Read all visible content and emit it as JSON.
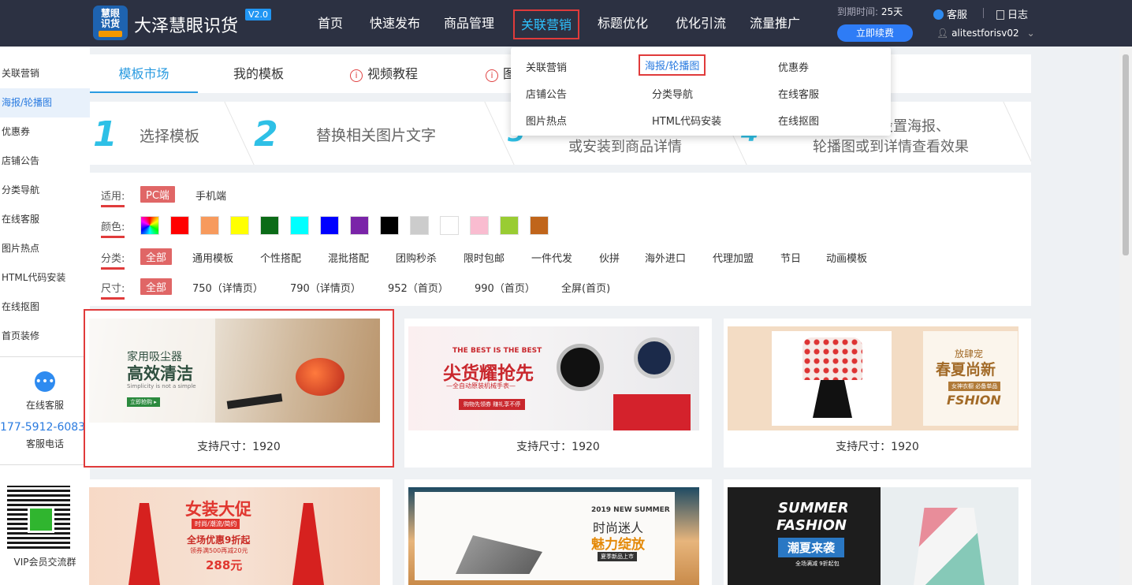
{
  "header": {
    "logo_text": "慧眼识货",
    "brand": "大泽慧眼识货",
    "version": "V2.0",
    "nav": [
      "首页",
      "快速发布",
      "商品管理",
      "关联营销",
      "标题优化",
      "优化引流",
      "流量推广"
    ],
    "expire_label": "到期时间:",
    "expire_value": "25天",
    "renew": "立即续费",
    "service": "客服",
    "log": "日志",
    "user": "alitestforisv02"
  },
  "dropdown": {
    "items": [
      "关联营销",
      "海报/轮播图",
      "优惠券",
      "店铺公告",
      "分类导航",
      "在线客服",
      "图片热点",
      "HTML代码安装",
      "在线抠图"
    ]
  },
  "sidebar": {
    "items": [
      "关联营销",
      "海报/轮播图",
      "优惠券",
      "店铺公告",
      "分类导航",
      "在线客服",
      "图片热点",
      "HTML代码安装",
      "在线抠图",
      "首页装修"
    ],
    "service": "在线客服",
    "phone": "177-5912-6083",
    "phone_label": "客服电话",
    "vip": "VIP会员交流群"
  },
  "tabs": [
    "模板市场",
    "我的模板",
    "视频教程",
    "图"
  ],
  "steps": {
    "s1_num": "1",
    "s1_text": "选择模板",
    "s2_num": "2",
    "s2_text": "替换相关图片文字",
    "s3_text": "或安装到商品详情",
    "s4_text_a": "台设置海报、",
    "s4_text_b": "轮播图或到详情查看效果"
  },
  "filters": {
    "apply_label": "适用:",
    "apply_opts": [
      "PC端",
      "手机端"
    ],
    "color_label": "颜色:",
    "colors": [
      "#ff0000",
      "#f79a5d",
      "#ffff00",
      "#0b6b17",
      "#00ffff",
      "#0000ff",
      "#7a24a8",
      "#000000",
      "#cccccc",
      "#ffffff",
      "#f9bcd0",
      "#99cc33",
      "#c0651b"
    ],
    "cat_label": "分类:",
    "cat_opts": [
      "全部",
      "通用模板",
      "个性搭配",
      "混批搭配",
      "团购秒杀",
      "限时包邮",
      "一件代发",
      "伙拼",
      "海外进口",
      "代理加盟",
      "节日",
      "动画模板"
    ],
    "size_label": "尺寸:",
    "size_opts": [
      "全部",
      "750（详情页）",
      "790（详情页）",
      "952（首页）",
      "990（首页）",
      "全屏(首页)"
    ]
  },
  "cards": [
    {
      "caption": "支持尺寸：1920",
      "t1": "家用吸尘器",
      "t2": "高效清洁",
      "t3": "Simplicity is not a simple",
      "t4": "立即抢购 ▸"
    },
    {
      "caption": "支持尺寸：1920",
      "t1": "THE BEST IS THE BEST",
      "t2": "尖货耀抢先",
      "t3": "—全自动原装机械手表—",
      "t4": "购物先领券 赚礼享不停"
    },
    {
      "caption": "支持尺寸：1920",
      "t1": "放肆宠",
      "t2": "春夏尚新",
      "t3": "女神衣橱 必备单品",
      "t4": "FSHION"
    },
    {
      "t1": "女装大促",
      "t2": "时尚/潮流/简约",
      "t3": "全场优惠9折起",
      "t4": "领券满500再减20元",
      "t5": "288元"
    },
    {
      "t1": "2019 NEW SUMMER",
      "t2": "时尚迷人",
      "t3": "魅力绽放",
      "t4": "夏季新品上市"
    },
    {
      "t1": "SUMMER",
      "t2": "FASHION",
      "t3": "潮夏来袭",
      "t4": "全场满减 9折起包"
    }
  ]
}
